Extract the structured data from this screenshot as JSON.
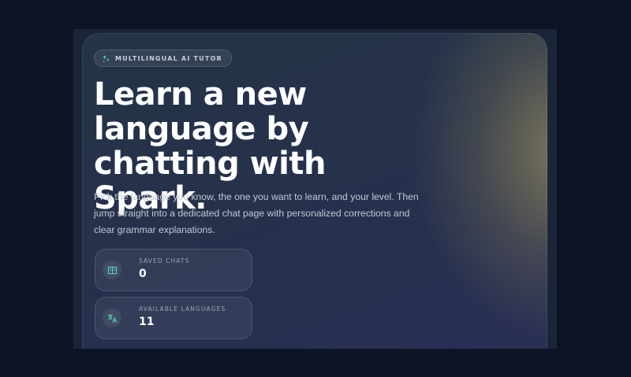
{
  "hero": {
    "badge_icon": "sparkle-icon",
    "badge_text": "MULTILINGUAL AI TUTOR",
    "headline": "Learn a new language by chatting with Spark.",
    "description": "Pick the language you know, the one you want to learn, and your level. Then jump straight into a dedicated chat page with personalized corrections and clear grammar explanations."
  },
  "stats": [
    {
      "icon": "book-icon",
      "label": "SAVED CHATS",
      "value": "0"
    },
    {
      "icon": "translate-icon",
      "label": "AVAILABLE LANGUAGES",
      "value": "11"
    }
  ],
  "colors": {
    "page_background": "#0d1426",
    "accent": "#5fd4c0",
    "glow": "#9a9060"
  }
}
